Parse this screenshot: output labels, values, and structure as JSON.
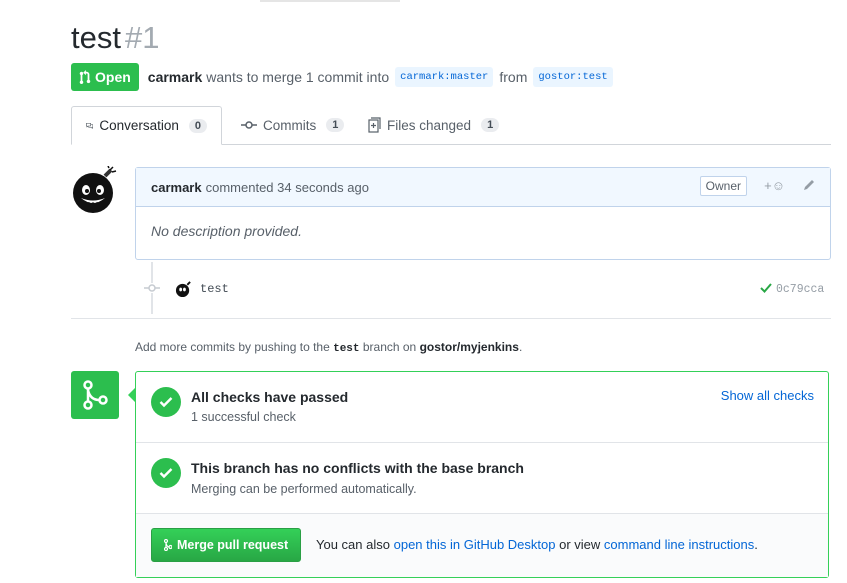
{
  "pr": {
    "title": "test",
    "number": "#1",
    "state": "Open",
    "author": "carmark",
    "summary": "wants to merge 1 commit into",
    "base_branch": "carmark:master",
    "from_word": "from",
    "head_branch": "gostor:test"
  },
  "tabs": [
    {
      "label": "Conversation",
      "count": "0",
      "icon": "comment-discussion-icon"
    },
    {
      "label": "Commits",
      "count": "1",
      "icon": "git-commit-icon"
    },
    {
      "label": "Files changed",
      "count": "1",
      "icon": "diff-icon"
    }
  ],
  "comment": {
    "author": "carmark",
    "action": "commented 34 seconds ago",
    "badge": "Owner",
    "body": "No description provided."
  },
  "commit": {
    "message": "test",
    "sha": "0c79cca"
  },
  "hint": {
    "prefix": "Add more commits by pushing to the",
    "branch": "test",
    "middle": "branch on",
    "repo": "gostor/myjenkins",
    "suffix": "."
  },
  "merge": {
    "checks_title": "All checks have passed",
    "checks_sub": "1 successful check",
    "show_checks": "Show all checks",
    "conflict_title": "This branch has no conflicts with the base branch",
    "conflict_sub": "Merging can be performed automatically.",
    "button": "Merge pull request",
    "also_text": "You can also",
    "desktop_link": "open this in GitHub Desktop",
    "or_view": "or view",
    "cli_link": "command line instructions",
    "end": "."
  },
  "colors": {
    "green": "#2cbe4e",
    "link": "#0366d6",
    "comment_header": "#f1f8ff"
  }
}
